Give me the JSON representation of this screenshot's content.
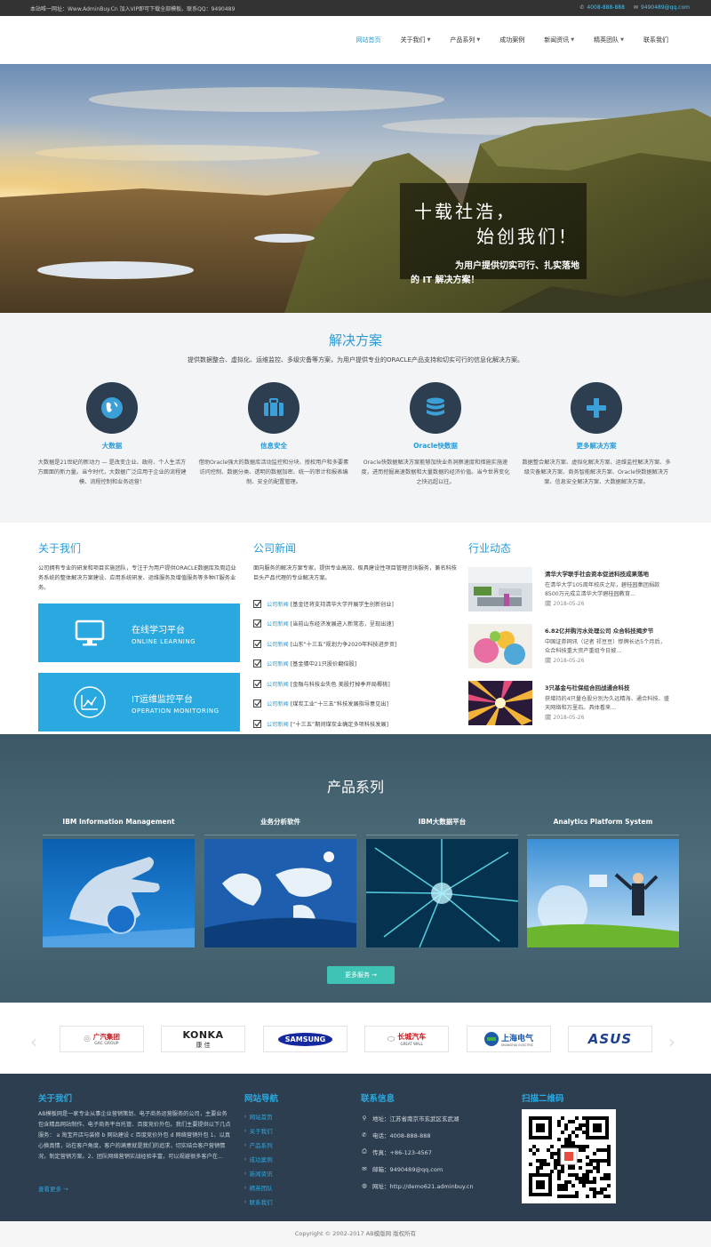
{
  "topbar": {
    "notice": "本站唯一网址：Www.AdminBuy.Cn 加入VIP即可下载全部模板。联系QQ：9490489",
    "phone": "4008-888-888",
    "email": "9490489@qq.com"
  },
  "nav": {
    "items": [
      {
        "label": "网站首页",
        "dropdown": false,
        "active": true
      },
      {
        "label": "关于我们",
        "dropdown": true
      },
      {
        "label": "产品系列",
        "dropdown": true
      },
      {
        "label": "成功案例",
        "dropdown": false
      },
      {
        "label": "新闻资讯",
        "dropdown": true
      },
      {
        "label": "精英团队",
        "dropdown": true
      },
      {
        "label": "联系我们",
        "dropdown": false
      }
    ]
  },
  "hero": {
    "script_line1": "十载社浩，",
    "script_line2": "始创我们！",
    "sub_line1": "为用户提供切实可行、扎实落地",
    "sub_line2": "的 IT 解决方案！"
  },
  "solutions": {
    "title": "解决方案",
    "desc": "提供数据整合、虚拟化、运维监控、多级灾备等方案，为用户提供专业的ORACLE产品支持和切实可行的信息化解决方案。",
    "items": [
      {
        "icon": "globe-icon",
        "title": "大数据",
        "text": "大数据是21世纪的新动力 — 是改变企业、政府、个人生活方方面面的新力量。当今时代，大数据广泛应用于企业的流程建模、流程控制和业务运营！"
      },
      {
        "icon": "briefcase-icon",
        "title": "信息安全",
        "text": "借助Oracle强大的数据库活动监控和分块、授权用户和多要素访问控制、数据分类、透明的数据加密、统一的审计和报表编制、安全的配置管理。"
      },
      {
        "icon": "database-icon",
        "title": "Oracle快数据",
        "text": "Oracle快数据解决方案能够加快业务洞察速度和措施实施速度，进而挖掘高速数据和大量数据的经济价值。当今世界变化之快远超以往。"
      },
      {
        "icon": "plus-icon",
        "title": "更多解决方案",
        "text": "数据整合解决方案、虚拟化解决方案、运维监控解决方案、多级灾备解决方案、商务智能解决方案、Oracle快数据解决方案、信息安全解决方案、大数据解决方案。"
      }
    ]
  },
  "about": {
    "title": "关于我们",
    "text": "公司拥有专业的研发和项目实施团队，专注于为用户提供ORACLE数据库及周边业务系统的整体解决方案建设、应用系统研发、运维服务及增值服务等多种IT服务业务。",
    "box1_title": "在线学习平台",
    "box1_sub": "ONLINE LEARNING",
    "box2_title": "IT运维监控平台",
    "box2_sub": "OPERATION MONITORING"
  },
  "news": {
    "title": "公司新闻",
    "text": "面向服务的解决方案专家，提供专业高效、极具建设性项目管理咨询服务，兼名科技巨头产品代理的专业解决方案。",
    "category": "公司新闻",
    "items": [
      "[基金还将支持清华大学开展学生创新创业]",
      "[当前山东经济发展进入新常态，呈现出速]",
      "[山东“十三五”规划力争2020年科技进步贡]",
      "[基金猜中21只股价翻倍股]",
      "[金融与科技业失色 美股打掉季开局椰桃]",
      "[煤炭工业“十三五”科技发展指导意见出]",
      "[“十三五”期间煤炭业确定多项科技发展]"
    ]
  },
  "industry": {
    "title": "行业动态",
    "items": [
      {
        "title": "清华大学联手社会资本促进科技成果落地",
        "text": "在清华大学105周年校庆之际，碧桂园集团捐款8500万元成立清华大学碧桂园教育...",
        "date": "2018-05-26"
      },
      {
        "title": "6.82亿并购污水处理公司 众合科技揭步节",
        "text": "中国证券网讯（记者 祁豆豆）惨牌长达5个月后，众合科技重大资产重组今日披...",
        "date": "2018-05-26"
      },
      {
        "title": "3只基金与社保组合回战通合科技",
        "text": "获增持的4只量仓股分别为久远精海、通合科技、盛天网络和万里石。具体看来...",
        "date": "2018-05-26"
      }
    ]
  },
  "products": {
    "title": "产品系列",
    "items": [
      {
        "title": "IBM Information Management"
      },
      {
        "title": "业务分析软件"
      },
      {
        "title": "IBM大数据平台"
      },
      {
        "title": "Analytics Platform System"
      }
    ],
    "more": "更多服务 →"
  },
  "partners": {
    "logos": [
      {
        "name": "广汽集团",
        "sub": "GAC GROUP",
        "color": "#c8161d"
      },
      {
        "name": "KONKA",
        "sub": "康 佳",
        "color": "#222"
      },
      {
        "name": "SAMSUNG",
        "sub": "",
        "color": "#1428a0"
      },
      {
        "name": "长城汽车",
        "sub": "GREAT WALL",
        "color": "#c8161d"
      },
      {
        "name": "上海电气",
        "sub": "SHANGHAI ELECTRIC",
        "color": "#1d5aa8"
      },
      {
        "name": "ASUS",
        "sub": "",
        "color": "#1c3f8f"
      }
    ]
  },
  "footer": {
    "about_title": "关于我们",
    "about_text": "AB模板网是一家专业从事企业营销策划、电子商务运营服务的公司，主要业务包含精品网站制作、电子商务平台托管、百度竞价外包。我们主要提供以下几点服务： a 淘宝开店与装修 b 网站建设 c 百度竞价外包 d 网络营销外包 1、以真心换真情，站在客户角度，客户的满意就是我们的追求，切实结合客户营销情况，制定营销方案。2、团队网络营销实战经验丰富，可以规避很多客户在...",
    "more": "查看更多 →",
    "nav_title": "网站导航",
    "nav_items": [
      "网站首页",
      "关于我们",
      "产品系列",
      "成功案例",
      "新闻资讯",
      "精英团队",
      "联系我们"
    ],
    "contact_title": "联系信息",
    "contact": [
      {
        "icon": "map-pin-icon",
        "text": "地址：江苏省南京市玄武区玄武湖"
      },
      {
        "icon": "phone-icon",
        "text": "电话：4008-888-888"
      },
      {
        "icon": "fax-icon",
        "text": "传真：+86-123-4567"
      },
      {
        "icon": "mail-icon",
        "text": "邮箱：9490489@qq.com"
      },
      {
        "icon": "globe-icon",
        "text": "网址：http://demo621.adminbuy.cn"
      }
    ],
    "qr_title": "扫描二维码"
  },
  "copyright": "Copyright © 2002-2017 AB模版网 版权所有",
  "colors": {
    "accent": "#2a9bd6",
    "dark": "#2d3e50",
    "teal": "#3fc3b4"
  }
}
